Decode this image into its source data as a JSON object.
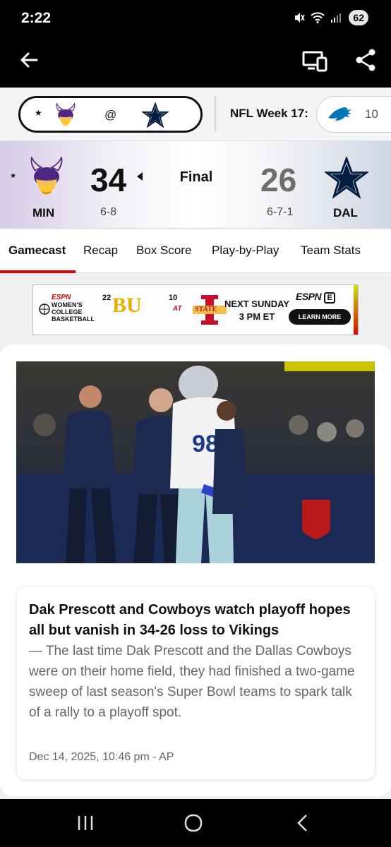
{
  "status_bar": {
    "time": "2:22",
    "battery": "62"
  },
  "score_strip": {
    "away_at": "@",
    "week_label": "NFL Week 17:",
    "next_game_score": "10"
  },
  "game": {
    "away": {
      "abbr": "MIN",
      "score": "34",
      "record": "6-8",
      "color": "#4f2683"
    },
    "home": {
      "abbr": "DAL",
      "score": "26",
      "record": "6-7-1",
      "color": "#041e42"
    },
    "status": "Final"
  },
  "tabs": [
    {
      "label": "Gamecast",
      "active": true
    },
    {
      "label": "Recap"
    },
    {
      "label": "Box Score"
    },
    {
      "label": "Play-by-Play"
    },
    {
      "label": "Team Stats"
    }
  ],
  "ad": {
    "brand": "ESPN",
    "title_line1": "WOMEN'S",
    "title_line2": "COLLEGE",
    "title_line3": "BASKETBALL",
    "team1_rank": "22",
    "team1_logo": "BU",
    "at": "AT",
    "team2_rank": "10",
    "team2_logo": "STATE",
    "next_line1": "NEXT SUNDAY",
    "next_line2": "3 PM ET",
    "network": "ESPN",
    "network_badge": "E",
    "cta": "LEARN MORE"
  },
  "story": {
    "headline": "Dak Prescott and Cowboys watch playoff hopes all but vanish in 34-26 loss to Vikings",
    "summary": "— The last time Dak Prescott and the Dallas Cowboys were on their home field, they had finished a two-game sweep of last season's Super Bowl teams to spark talk of a rally to a playoff spot.",
    "meta": "Dec 14, 2025, 10:46 pm - AP",
    "jersey_number": "98"
  },
  "colors": {
    "accent": "#dd0000"
  }
}
